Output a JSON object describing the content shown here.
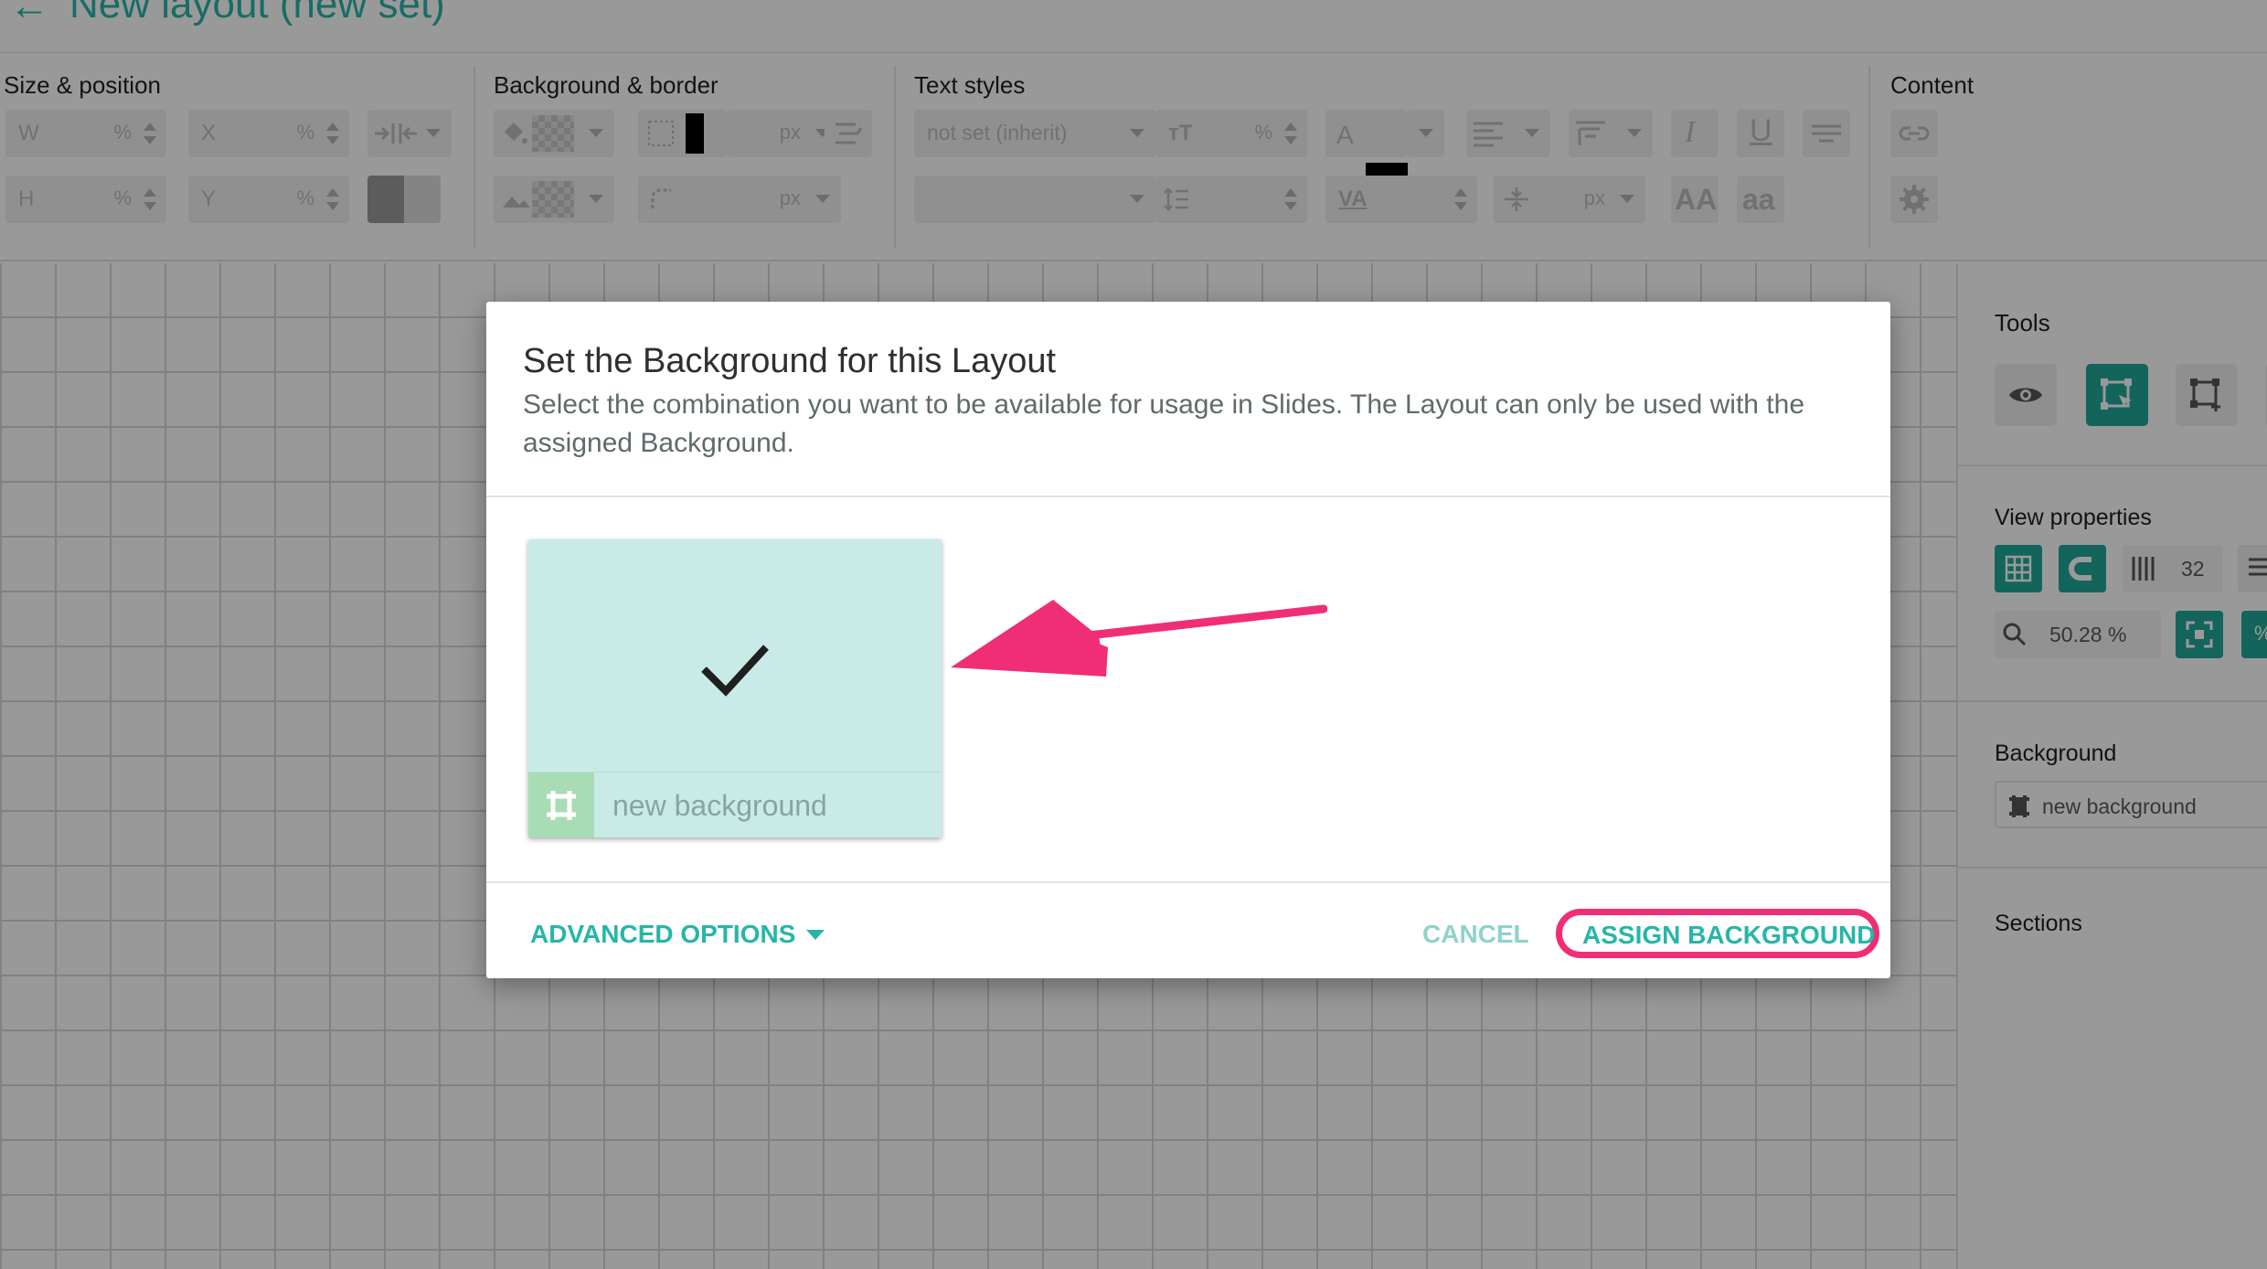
{
  "app": {
    "back_label": "←",
    "title": "New layout (new set)"
  },
  "toolbar": {
    "size_position": {
      "label": "Size & position",
      "w_label": "W",
      "h_label": "H",
      "x_label": "X",
      "y_label": "Y",
      "unit": "%"
    },
    "background_border": {
      "label": "Background & border",
      "unit_px": "px",
      "border_color": "#000000"
    },
    "text_styles": {
      "label": "Text styles",
      "font_placeholder": "not set (inherit)",
      "unit_pct": "%",
      "unit_px": "px",
      "text_color": "#000000",
      "font_size_icon": "ᴛT",
      "va_label": "VA",
      "a_label": "A",
      "italic_label": "I",
      "underline_label": "U",
      "caps_label": "AA",
      "lower_label": "aa"
    },
    "content": {
      "label": "Content"
    }
  },
  "right_panel": {
    "tools_label": "Tools",
    "view_properties_label": "View properties",
    "grid_columns": "32",
    "zoom_value": "50.28 %",
    "zoom_extra": "%",
    "background_label": "Background",
    "background_value": "new background",
    "sections_label": "Sections"
  },
  "dialog": {
    "title": "Set the Background for this Layout",
    "subtitle": "Select the combination you want to be available for usage in Slides. The Layout can only be used with the assigned Background.",
    "backgrounds": [
      {
        "name": "new background",
        "selected": true,
        "color": "#c8ebe8"
      }
    ],
    "advanced_options_label": "ADVANCED OPTIONS",
    "cancel_label": "CANCEL",
    "assign_label": "ASSIGN BACKGROUND"
  },
  "colors": {
    "accent": "#26b6a8",
    "accent_dark": "#21a99a",
    "highlight": "#ef2e75"
  }
}
